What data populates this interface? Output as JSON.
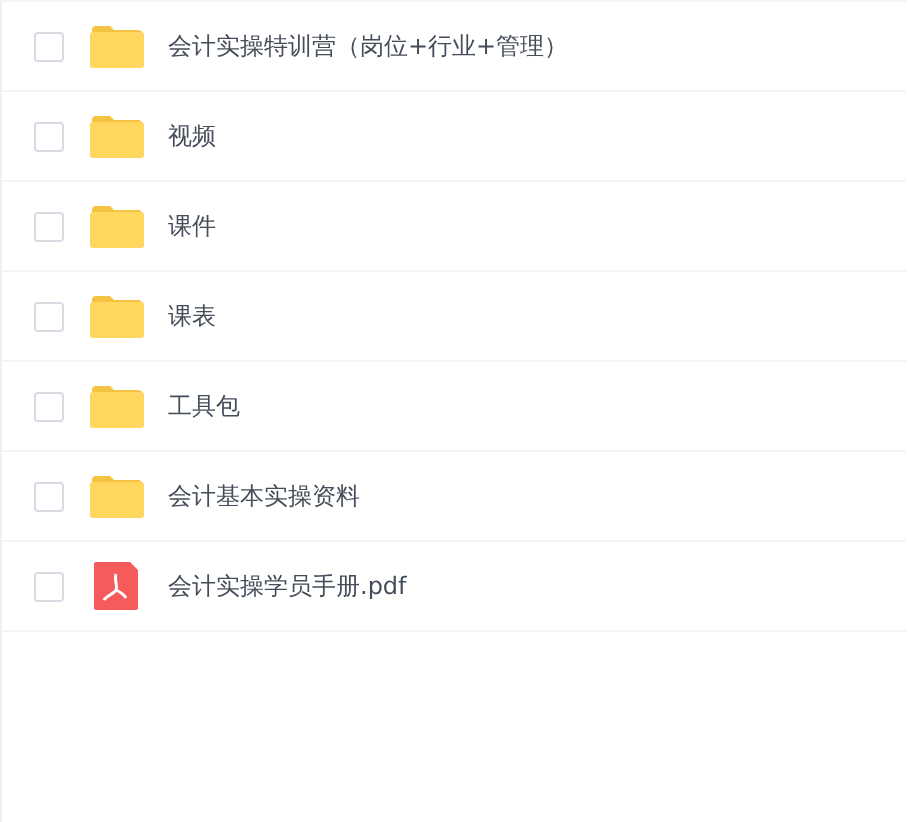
{
  "files": [
    {
      "name": "会计实操特训营（岗位+行业+管理）",
      "kind": "folder",
      "checked": false
    },
    {
      "name": "视频",
      "kind": "folder",
      "checked": false
    },
    {
      "name": "课件",
      "kind": "folder",
      "checked": false
    },
    {
      "name": "课表",
      "kind": "folder",
      "checked": false
    },
    {
      "name": "工具包",
      "kind": "folder",
      "checked": false
    },
    {
      "name": "会计基本实操资料",
      "kind": "folder",
      "checked": false
    },
    {
      "name": "会计实操学员手册.pdf",
      "kind": "pdf",
      "checked": false
    }
  ]
}
